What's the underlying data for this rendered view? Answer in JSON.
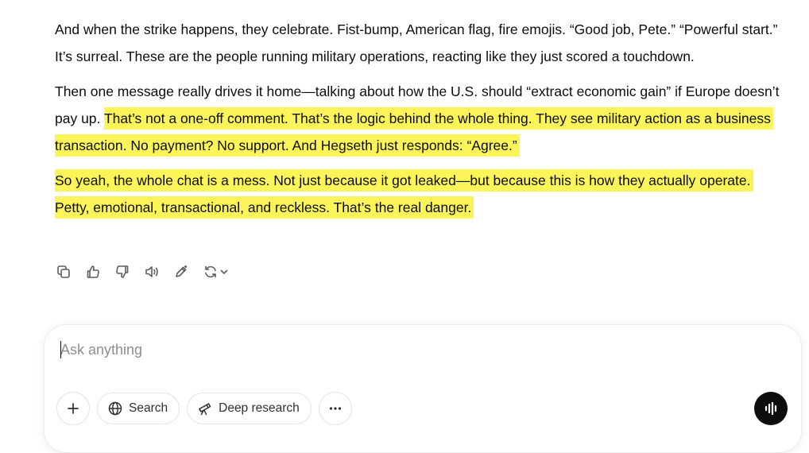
{
  "message": {
    "p1": "And when the strike happens, they celebrate. Fist-bump, American flag, fire emojis. “Good job, Pete.” “Powerful start.” It’s surreal. These are the people running military operations, reacting like they just scored a touchdown.",
    "p2_plain": "Then one message really drives it home—talking about how the U.S. should “extract economic gain” if Europe doesn’t pay up. ",
    "p2_highlight": "That’s not a one-off comment. That’s the logic behind the whole thing. They see military action as a business transaction. No payment? No support. And Hegseth just responds: “Agree.”",
    "p3_highlight": "So yeah, the whole chat is a mess. Not just because it got leaked—but because this is how they actually operate. Petty, emotional, transactional, and reckless. That’s the real danger."
  },
  "actions": {
    "icons": [
      "copy-icon",
      "thumbs-up-icon",
      "thumbs-down-icon",
      "read-aloud-icon",
      "edit-icon",
      "regenerate-icon",
      "chevron-down-icon"
    ]
  },
  "composer": {
    "placeholder": "Ask anything",
    "value": "",
    "search_label": "Search",
    "deep_research_label": "Deep research"
  },
  "colors": {
    "highlight": "#fbf55a",
    "text": "#0d0d0d",
    "placeholder": "#8e8e8e",
    "voice_button": "#0d0d0d"
  }
}
